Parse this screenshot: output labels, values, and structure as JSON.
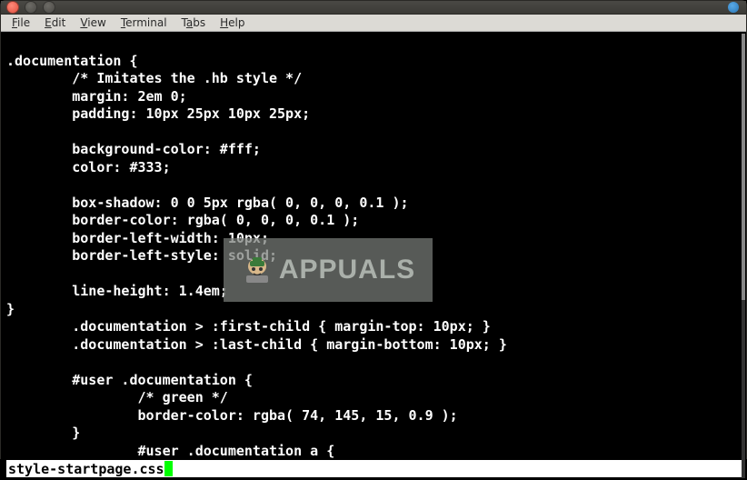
{
  "menubar": {
    "items": [
      {
        "label": "File",
        "accel": "F"
      },
      {
        "label": "Edit",
        "accel": "E"
      },
      {
        "label": "View",
        "accel": "V"
      },
      {
        "label": "Terminal",
        "accel": "T"
      },
      {
        "label": "Tabs",
        "accel": "a"
      },
      {
        "label": "Help",
        "accel": "H"
      }
    ]
  },
  "terminal": {
    "lines": [
      ".documentation {",
      "        /* Imitates the .hb style */",
      "        margin: 2em 0;",
      "        padding: 10px 25px 10px 25px;",
      "",
      "        background-color: #fff;",
      "        color: #333;",
      "",
      "        box-shadow: 0 0 5px rgba( 0, 0, 0, 0.1 );",
      "        border-color: rgba( 0, 0, 0, 0.1 );",
      "        border-left-width: 10px;",
      "        border-left-style: solid;",
      "",
      "        line-height: 1.4em;",
      "}",
      "        .documentation > :first-child { margin-top: 10px; }",
      "        .documentation > :last-child { margin-bottom: 10px; }",
      "",
      "        #user .documentation {",
      "                /* green */",
      "                border-color: rgba( 74, 145, 15, 0.9 );",
      "        }",
      "                #user .documentation a {"
    ]
  },
  "status": {
    "filename": "style-startpage.css"
  },
  "watermark": {
    "text": "APPUALS"
  }
}
